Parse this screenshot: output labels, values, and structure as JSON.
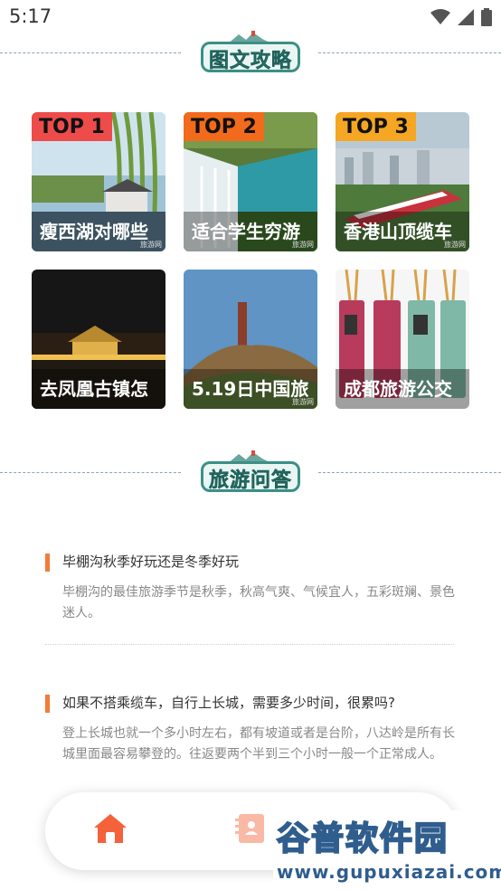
{
  "status_bar": {
    "time": "5:17"
  },
  "sections": {
    "guides_title": "图文攻略",
    "qa_title": "旅游问答"
  },
  "guide_cards": [
    {
      "rank": "TOP 1",
      "title": "瘦西湖对哪些",
      "watermark": "旅游网"
    },
    {
      "rank": "TOP 2",
      "title": "适合学生穷游",
      "watermark": "旅游网"
    },
    {
      "rank": "TOP 3",
      "title": "香港山顶缆车",
      "watermark": "旅游网"
    },
    {
      "title": "去凤凰古镇怎"
    },
    {
      "title": "5.19日中国旅",
      "watermark": "旅游网"
    },
    {
      "title": "成都旅游公交"
    }
  ],
  "qa_items": [
    {
      "question": "毕棚沟秋季好玩还是冬季好玩",
      "answer": "毕棚沟的最佳旅游季节是秋季，秋高气爽、气候宜人，五彩斑斓、景色迷人。"
    },
    {
      "question": "如果不搭乘缆车，自行上长城，需要多少时间，很累吗?",
      "answer": "登上长城也就一个多小时左右，都有坡道或者是台阶，八达岭是所有长城里面最容易攀登的。往返要两个半到三个小时一般一个正常成人。"
    }
  ],
  "tabbar": {
    "icons": [
      "home-icon",
      "contacts-icon",
      "profile-icon"
    ],
    "active_color": "#f4623a"
  },
  "site_watermark": {
    "title": "谷普软件园",
    "url": "www.gupuxiazai.com"
  },
  "colors": {
    "accent": "#f37b3a",
    "badge_teal": "#2f8a80",
    "top1": "#ee4b4b",
    "top2": "#f26a1b",
    "top3": "#f5a623"
  }
}
